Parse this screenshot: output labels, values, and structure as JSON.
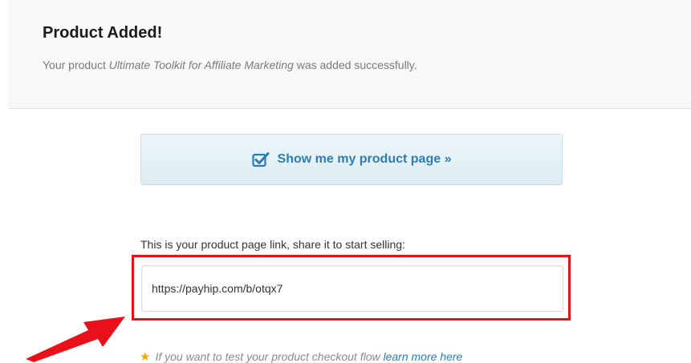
{
  "header": {
    "title": "Product Added!",
    "subtitle_prefix": "Your product ",
    "product_name": "Ultimate Toolkit for Affiliate Marketing",
    "subtitle_suffix": " was added successfully."
  },
  "product_page_button": {
    "label": "Show me my product page »",
    "icon": "checkbox-check-icon"
  },
  "share": {
    "label": "This is your product page link, share it to start selling:",
    "link_value": "https://payhip.com/b/otqx7"
  },
  "tip": {
    "icon": "star-icon",
    "text": "If you want to test your product checkout flow ",
    "link_label": "learn more here"
  },
  "annotation": {
    "arrow_color": "#e8111a",
    "box_color": "#e8111a"
  },
  "colors": {
    "accent": "#2f7db0",
    "star": "#f0a500"
  }
}
